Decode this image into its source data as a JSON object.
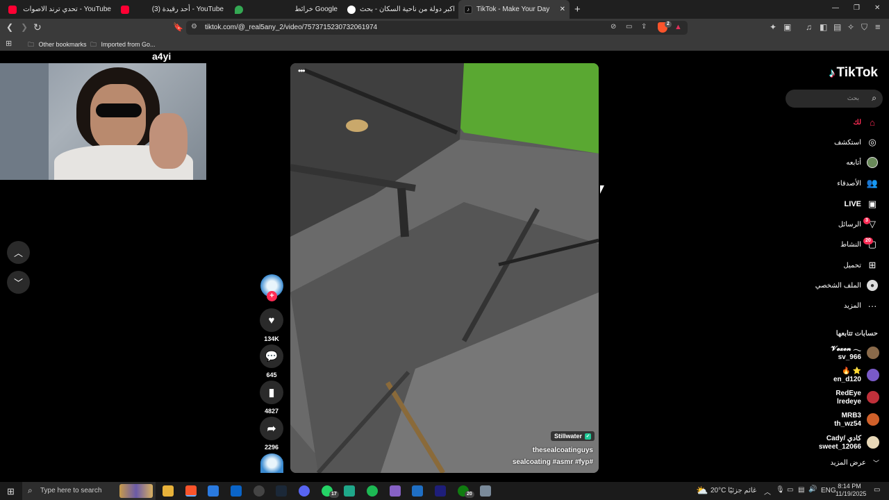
{
  "browser": {
    "tabs": [
      {
        "label": "تحدي ترند الاصوات - YouTube",
        "icon": "youtube-icon",
        "color": "#ff0000"
      },
      {
        "label": "(3) أحد رقيدة - YouTube",
        "icon": "youtube-icon",
        "color": "#ff0000"
      },
      {
        "label": "خرائط Google",
        "icon": "maps-icon",
        "color": "#34a853"
      },
      {
        "label": "اكبر دولة من ناحية السكان - بحث Google",
        "icon": "google-icon",
        "color": "#4285f4"
      },
      {
        "label": "TikTok - Make Your Day",
        "icon": "tiktok-icon",
        "color": "#ffffff"
      }
    ],
    "new_tab": "+",
    "window_controls": {
      "minimize": "—",
      "restore": "❐",
      "close": "✕"
    },
    "url": "tiktok.com/@_real5any_2/video/7573715230732061974",
    "bookmarks": [
      {
        "label": "Other bookmarks"
      },
      {
        "label": "Imported from Go..."
      }
    ],
    "extension_badge": "2"
  },
  "webcam": {
    "label": "a4yi"
  },
  "tiktok": {
    "logo": "TikTok",
    "search_placeholder": "بحث",
    "nav": [
      {
        "label": "لك",
        "icon": "home-icon",
        "active": true
      },
      {
        "label": "استكشف",
        "icon": "compass-icon"
      },
      {
        "label": "أتابعه",
        "icon": "following-avatar-icon"
      },
      {
        "label": "الأصدقاء",
        "icon": "friends-icon"
      },
      {
        "label": "LIVE",
        "icon": "live-icon"
      },
      {
        "label": "الرسائل",
        "icon": "messages-icon",
        "badge": "3"
      },
      {
        "label": "النشاط",
        "icon": "activity-icon",
        "badge": "20"
      },
      {
        "label": "تحميل",
        "icon": "upload-icon"
      },
      {
        "label": "الملف الشخصي",
        "icon": "profile-icon"
      },
      {
        "label": "المزيد",
        "icon": "more-icon"
      }
    ],
    "following_title": "حسابات تتابعها",
    "following": [
      {
        "line1": "𝓥𝓮𝔁𝓮𝓷 𓂃",
        "line2": "sv_966",
        "color": "#8a6a4a"
      },
      {
        "line1": "🔥 ⭐",
        "line2": "en_d120",
        "color": "#7a5ac8"
      },
      {
        "line1": "RedEye",
        "line2": "lredeye",
        "color": "#c0303a"
      },
      {
        "line1": "MRB3",
        "line2": "th_wz54",
        "color": "#d0602a"
      },
      {
        "line1": "Cady/ كادي",
        "line2": "sweet_12066",
        "color": "#e8d8b8"
      }
    ],
    "show_more": "عرض المزيد",
    "video": {
      "more_menu": "•••",
      "sound_label": "Stillwater",
      "author": "thesealcoatinguys",
      "hashtags": "#sealcoating #asmr #fyp"
    },
    "actions": {
      "likes": "134K",
      "comments": "645",
      "saves": "4827",
      "shares": "2296"
    },
    "accent_color": "#fe2c55"
  },
  "taskbar": {
    "search_placeholder": "Type here to search",
    "weather": "20°C  غائم جزئيًا",
    "language": "ENG",
    "time": "8:14 PM",
    "date": "11/19/2025",
    "whatsapp_badge": "17",
    "xbox_badge": "20"
  }
}
